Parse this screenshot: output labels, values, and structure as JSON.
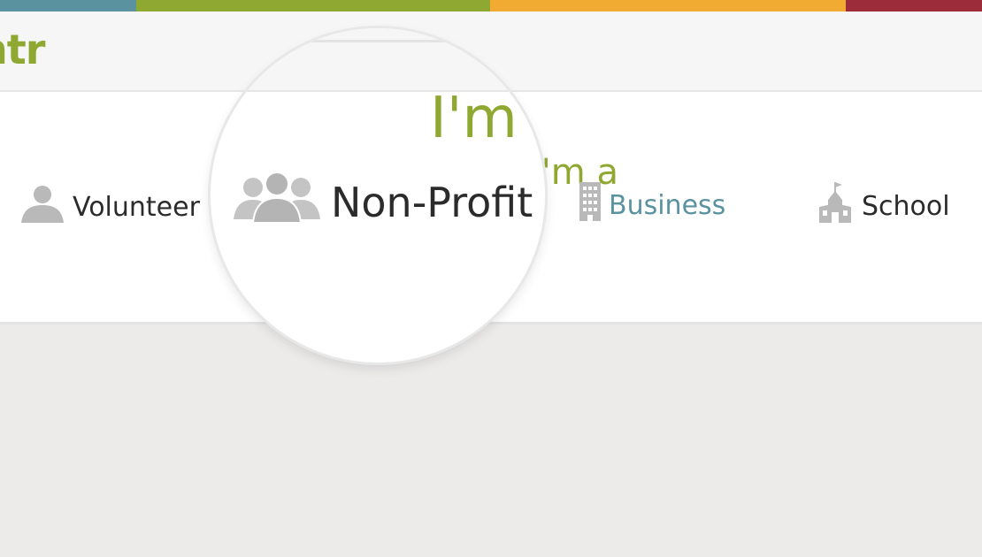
{
  "header": {
    "logo_text": "ntr"
  },
  "main": {
    "heading": "I'm a",
    "heading_magnified": "I'm",
    "options": [
      {
        "label": "Volunteer",
        "icon": "person-icon"
      },
      {
        "label": "Non-Profit",
        "icon": "group-icon"
      },
      {
        "label": "Business",
        "icon": "building-icon"
      },
      {
        "label": "School",
        "icon": "schoolhouse-icon"
      }
    ]
  },
  "colors": {
    "stripe_teal": "#5b92a0",
    "stripe_green": "#8ea831",
    "stripe_orange": "#f1ab33",
    "stripe_red": "#9c2c39",
    "accent": "#8ea831",
    "business_text": "#5b92a0",
    "icon_gray": "#b9b9b9"
  }
}
